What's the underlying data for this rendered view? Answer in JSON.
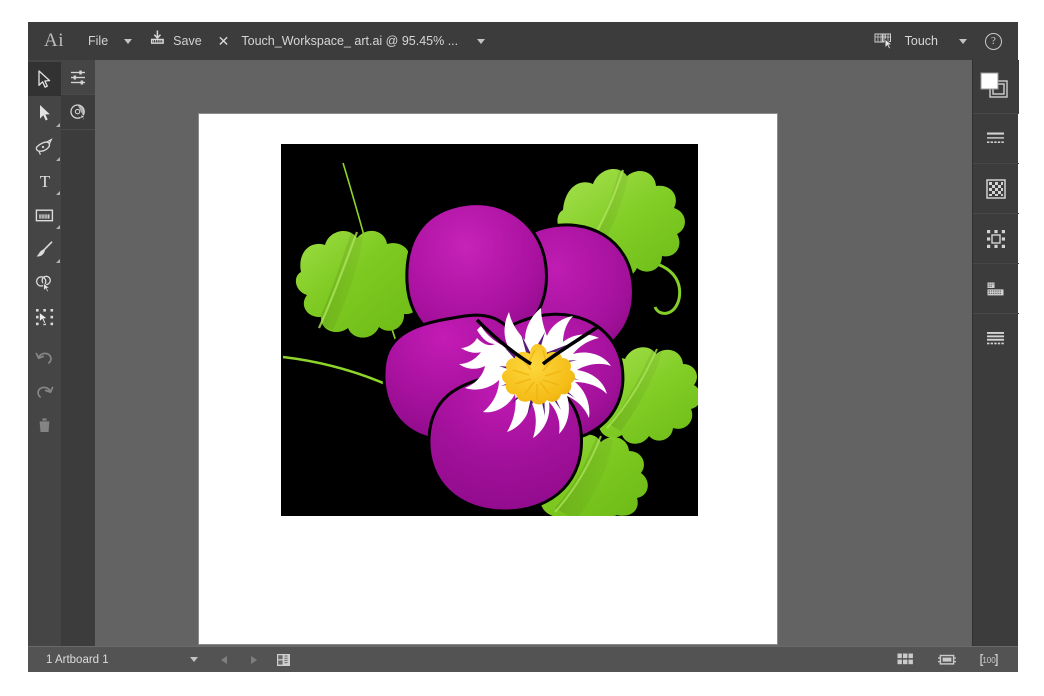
{
  "app": {
    "logo": "Ai",
    "name": "Adobe Illustrator"
  },
  "menubar": {
    "file_label": "File",
    "file_caret_icon": "chevron-down-icon",
    "save_label": "Save",
    "save_icon": "save-icon",
    "close_icon": "close-x-icon",
    "document_title": "Touch_Workspace_ art.ai @ 95.45% ...",
    "document_caret_icon": "chevron-down-icon",
    "touch_workspace_icon": "touch-workspace-icon",
    "touch_label": "Touch",
    "touch_caret_icon": "chevron-down-icon",
    "help_label": "?",
    "help_icon": "help-icon"
  },
  "toolbar": {
    "tools": [
      {
        "name": "selection-tool",
        "label": "Selection",
        "active": true,
        "has_flyout": false,
        "dim": false
      },
      {
        "name": "direct-selection-tool",
        "label": "Direct Selection",
        "active": false,
        "has_flyout": true,
        "dim": false
      },
      {
        "name": "pen-tool",
        "label": "Pen",
        "active": false,
        "has_flyout": true,
        "dim": false
      },
      {
        "name": "type-tool",
        "label": "Type",
        "active": false,
        "has_flyout": true,
        "dim": false
      },
      {
        "name": "rectangle-tool",
        "label": "Rectangle",
        "active": false,
        "has_flyout": true,
        "dim": false
      },
      {
        "name": "paintbrush-tool",
        "label": "Paintbrush",
        "active": false,
        "has_flyout": true,
        "dim": false
      },
      {
        "name": "shape-builder-tool",
        "label": "Shape Builder",
        "active": false,
        "has_flyout": false,
        "dim": false
      },
      {
        "name": "free-transform-tool",
        "label": "Free Transform",
        "active": false,
        "has_flyout": false,
        "dim": false
      },
      {
        "name": "undo-button",
        "label": "Undo",
        "active": false,
        "has_flyout": false,
        "dim": true
      },
      {
        "name": "redo-button",
        "label": "Redo",
        "active": false,
        "has_flyout": false,
        "dim": true
      },
      {
        "name": "delete-button",
        "label": "Delete",
        "active": false,
        "has_flyout": false,
        "dim": true
      }
    ]
  },
  "panel_column": {
    "buttons": [
      {
        "name": "properties-panel-button",
        "label": "Properties",
        "icon": "sliders-icon",
        "active": true
      },
      {
        "name": "color-panel-button",
        "label": "Color",
        "icon": "color-wheel-icon",
        "active": false
      }
    ]
  },
  "right_panel": {
    "fill_stroke": {
      "name": "fill-stroke-swatch",
      "label": "Fill and Stroke",
      "fill_color": "#ffffff",
      "stroke_color": "#ffffff"
    },
    "buttons": [
      {
        "name": "stroke-panel-button",
        "label": "Stroke",
        "icon": "stroke-lines-icon"
      },
      {
        "name": "transparency-panel-button",
        "label": "Transparency",
        "icon": "checkerboard-icon"
      },
      {
        "name": "transform-panel-button",
        "label": "Transform",
        "icon": "transform-handles-icon"
      },
      {
        "name": "align-panel-button",
        "label": "Align",
        "icon": "align-icon"
      },
      {
        "name": "layers-panel-button",
        "label": "Layers",
        "icon": "layers-lines-icon"
      }
    ]
  },
  "statusbar": {
    "artboard_value": "1 Artboard 1",
    "artboard_caret_icon": "chevron-down-icon",
    "prev_artboard_icon": "arrow-left-icon",
    "next_artboard_icon": "arrow-right-icon",
    "artboard_nav_icon": "artboard-navigation-icon",
    "right_icons": [
      {
        "name": "arrange-documents-icon",
        "label": "Arrange Documents"
      },
      {
        "name": "screen-mode-icon",
        "label": "Screen Mode"
      },
      {
        "name": "zoom-level-icon",
        "label": "Zoom 100%"
      }
    ]
  },
  "canvas": {
    "artboard_background": "#ffffff",
    "canvas_background": "#636363",
    "artwork_title": "Pansy Flower Illustration",
    "artwork_background": "#000000",
    "colors": {
      "petal_light": "#c41bb6",
      "petal_mid": "#a3119b",
      "petal_dark": "#79077a",
      "leaf_light": "#9ad93a",
      "leaf_mid": "#7dc924",
      "leaf_dark": "#5fae12",
      "stem": "#8ed42b",
      "center_white": "#ffffff",
      "center_yellow": "#f6c120",
      "center_purple": "#5b1b7a",
      "outline": "#000000"
    }
  }
}
